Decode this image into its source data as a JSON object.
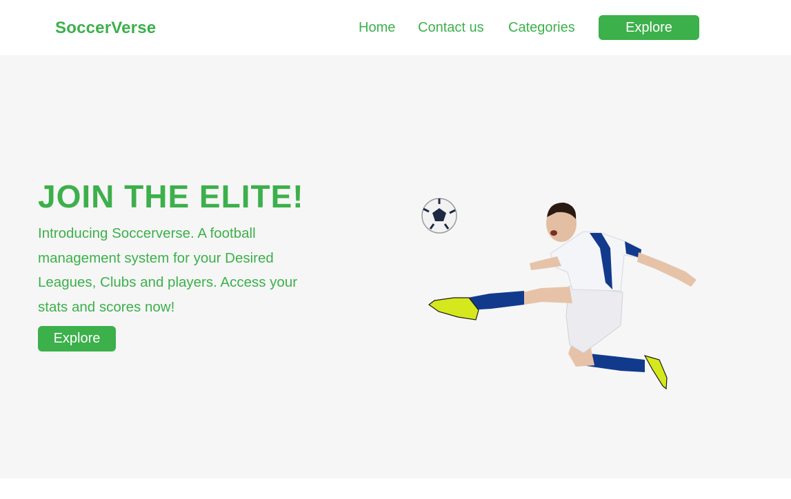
{
  "navbar": {
    "brand": "SoccerVerse",
    "links": [
      "Home",
      "Contact us",
      "Categories"
    ],
    "cta_label": "Explore"
  },
  "hero": {
    "title": "JOIN THE ELITE!",
    "description": "Introducing Soccerverse. A football management system for your Desired Leagues, Clubs and players. Access your stats and scores now!",
    "cta_label": "Explore"
  },
  "colors": {
    "accent": "#3cb04b",
    "hero_background": "#f6f6f6",
    "navbar_background": "#ffffff"
  }
}
